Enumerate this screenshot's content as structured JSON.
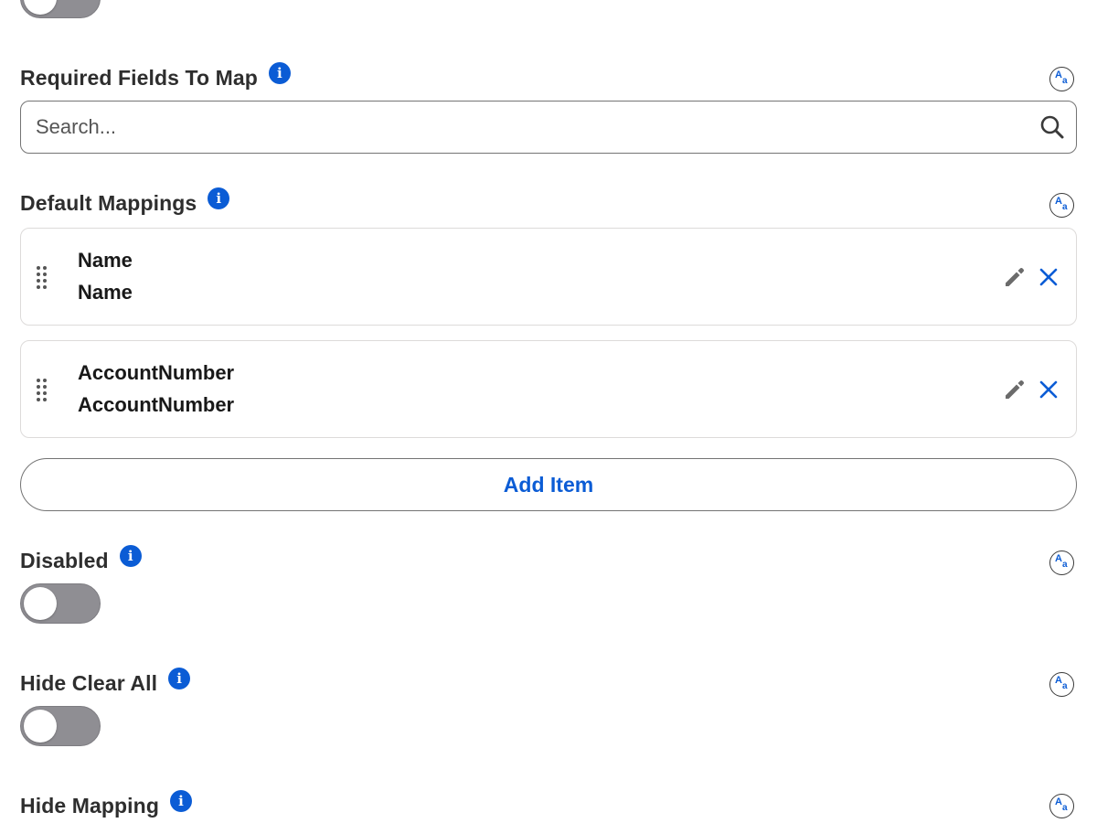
{
  "fields": {
    "required_fields": {
      "label": "Required Fields To Map",
      "search_placeholder": "Search..."
    },
    "default_mappings": {
      "label": "Default Mappings",
      "items": [
        {
          "line1": "Name",
          "line2": "Name"
        },
        {
          "line1": "AccountNumber",
          "line2": "AccountNumber"
        }
      ],
      "add_label": "Add Item"
    },
    "disabled": {
      "label": "Disabled",
      "checked": false
    },
    "hide_clear_all": {
      "label": "Hide Clear All",
      "checked": false
    },
    "hide_mapping": {
      "label": "Hide Mapping"
    }
  },
  "icons": {
    "info": "info-icon",
    "info_glyph": "i",
    "translate": "aa-icon",
    "translate_glyph_upper": "A",
    "translate_glyph_lower": "a",
    "search": "search-icon",
    "drag": "drag-handle-icon",
    "edit": "pencil-icon",
    "remove": "close-icon"
  },
  "colors": {
    "accent": "#0b5cd5",
    "toggle_off": "#8f8e93",
    "border": "#747474",
    "card_border": "#dddbda"
  }
}
